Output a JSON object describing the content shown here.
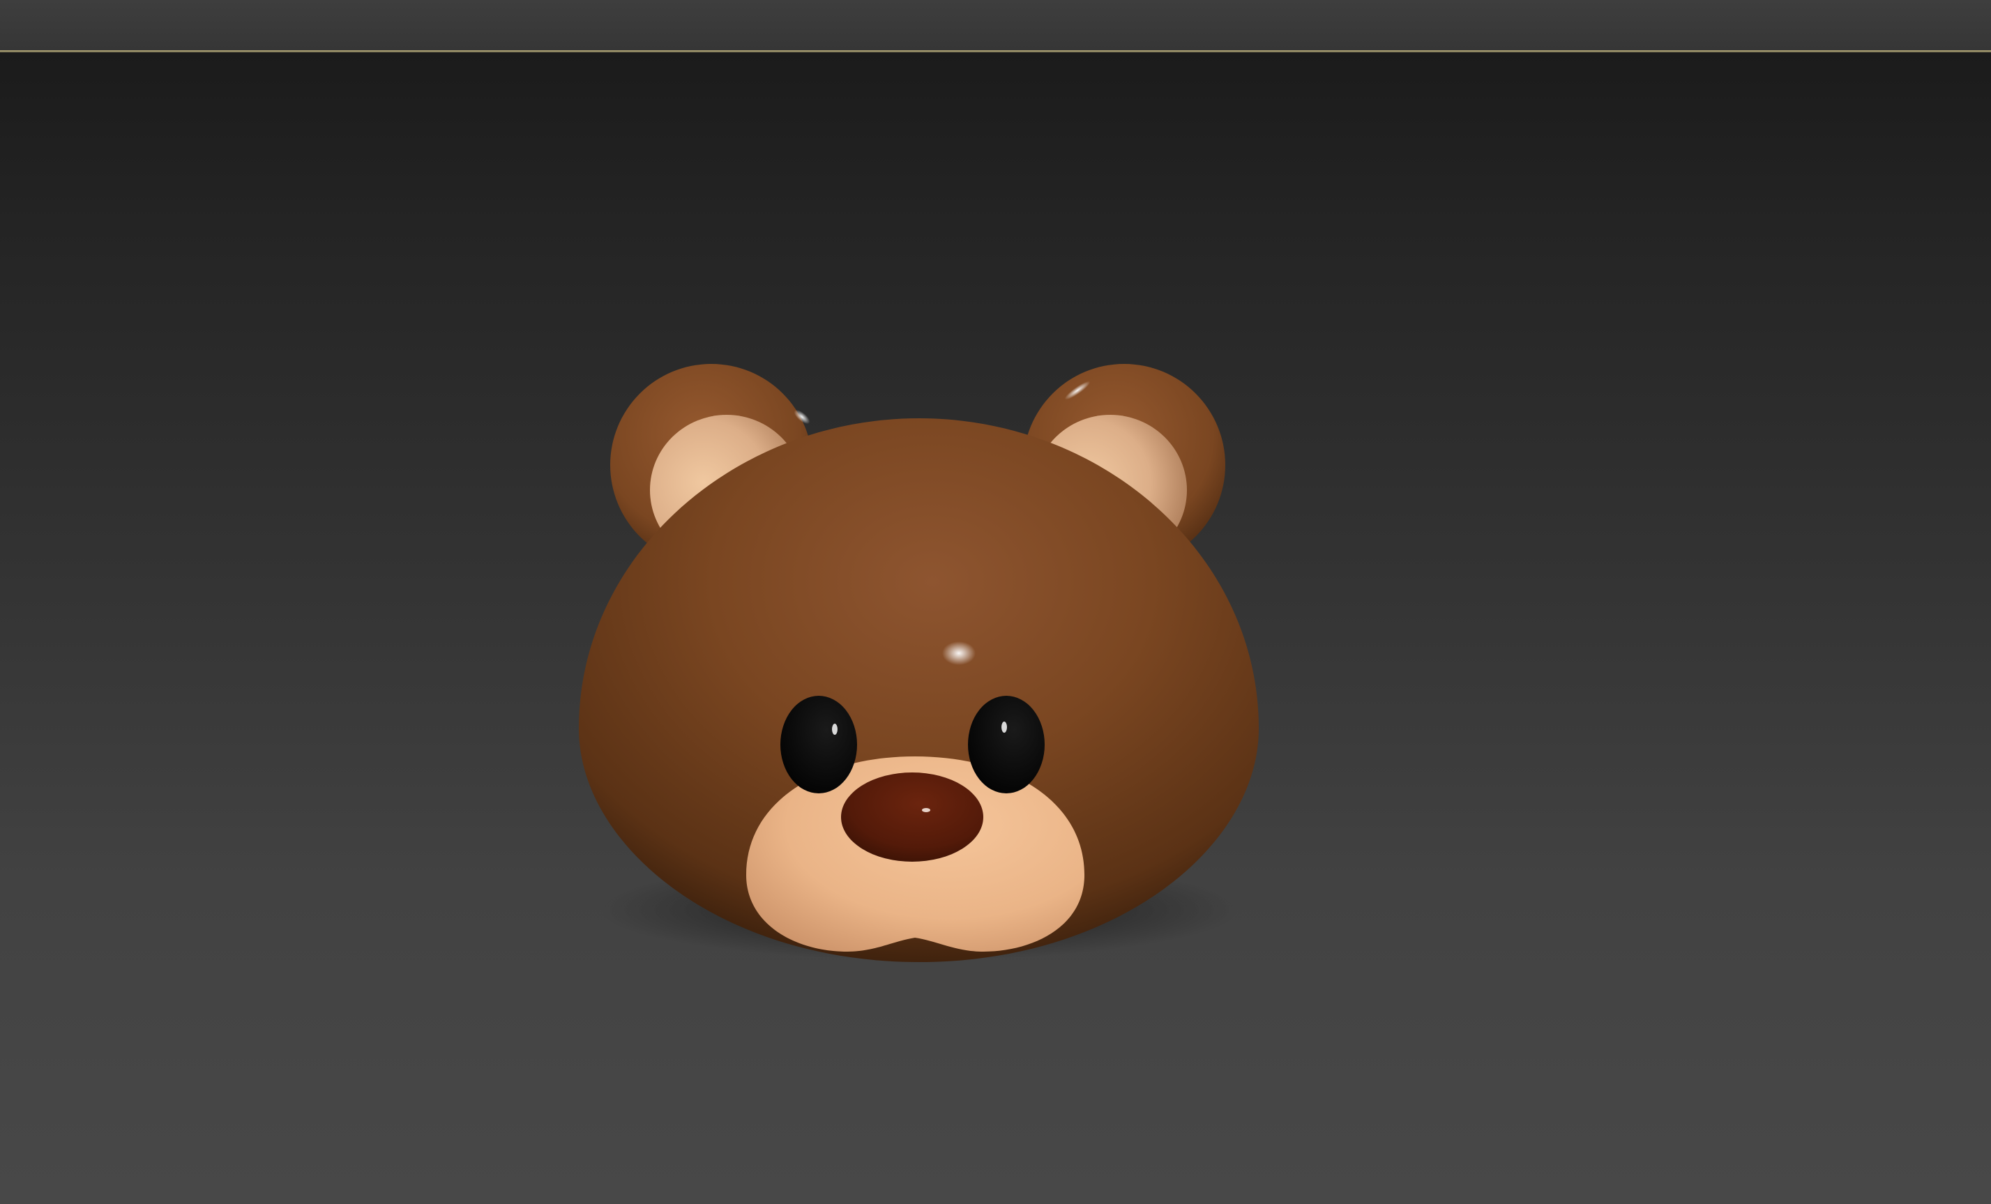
{
  "window": {
    "title": ""
  },
  "viewport": {
    "active": true,
    "background_top": "#1b1b1b",
    "background_bottom": "#484848",
    "active_border_color": "#8f8763"
  },
  "scene": {
    "object": "bear-head",
    "colors": {
      "fur": "#7a4621",
      "fur_light": "#8e5530",
      "fur_dark": "#3a1f0c",
      "muzzle": "#f2bf92",
      "inner_ear": "#e2b48e",
      "nose": "#5a1c0a",
      "eyes": "#060606"
    },
    "icons": [
      "bear-head-model",
      "left-ear",
      "right-ear",
      "left-eye",
      "right-eye",
      "nose",
      "muzzle"
    ]
  }
}
